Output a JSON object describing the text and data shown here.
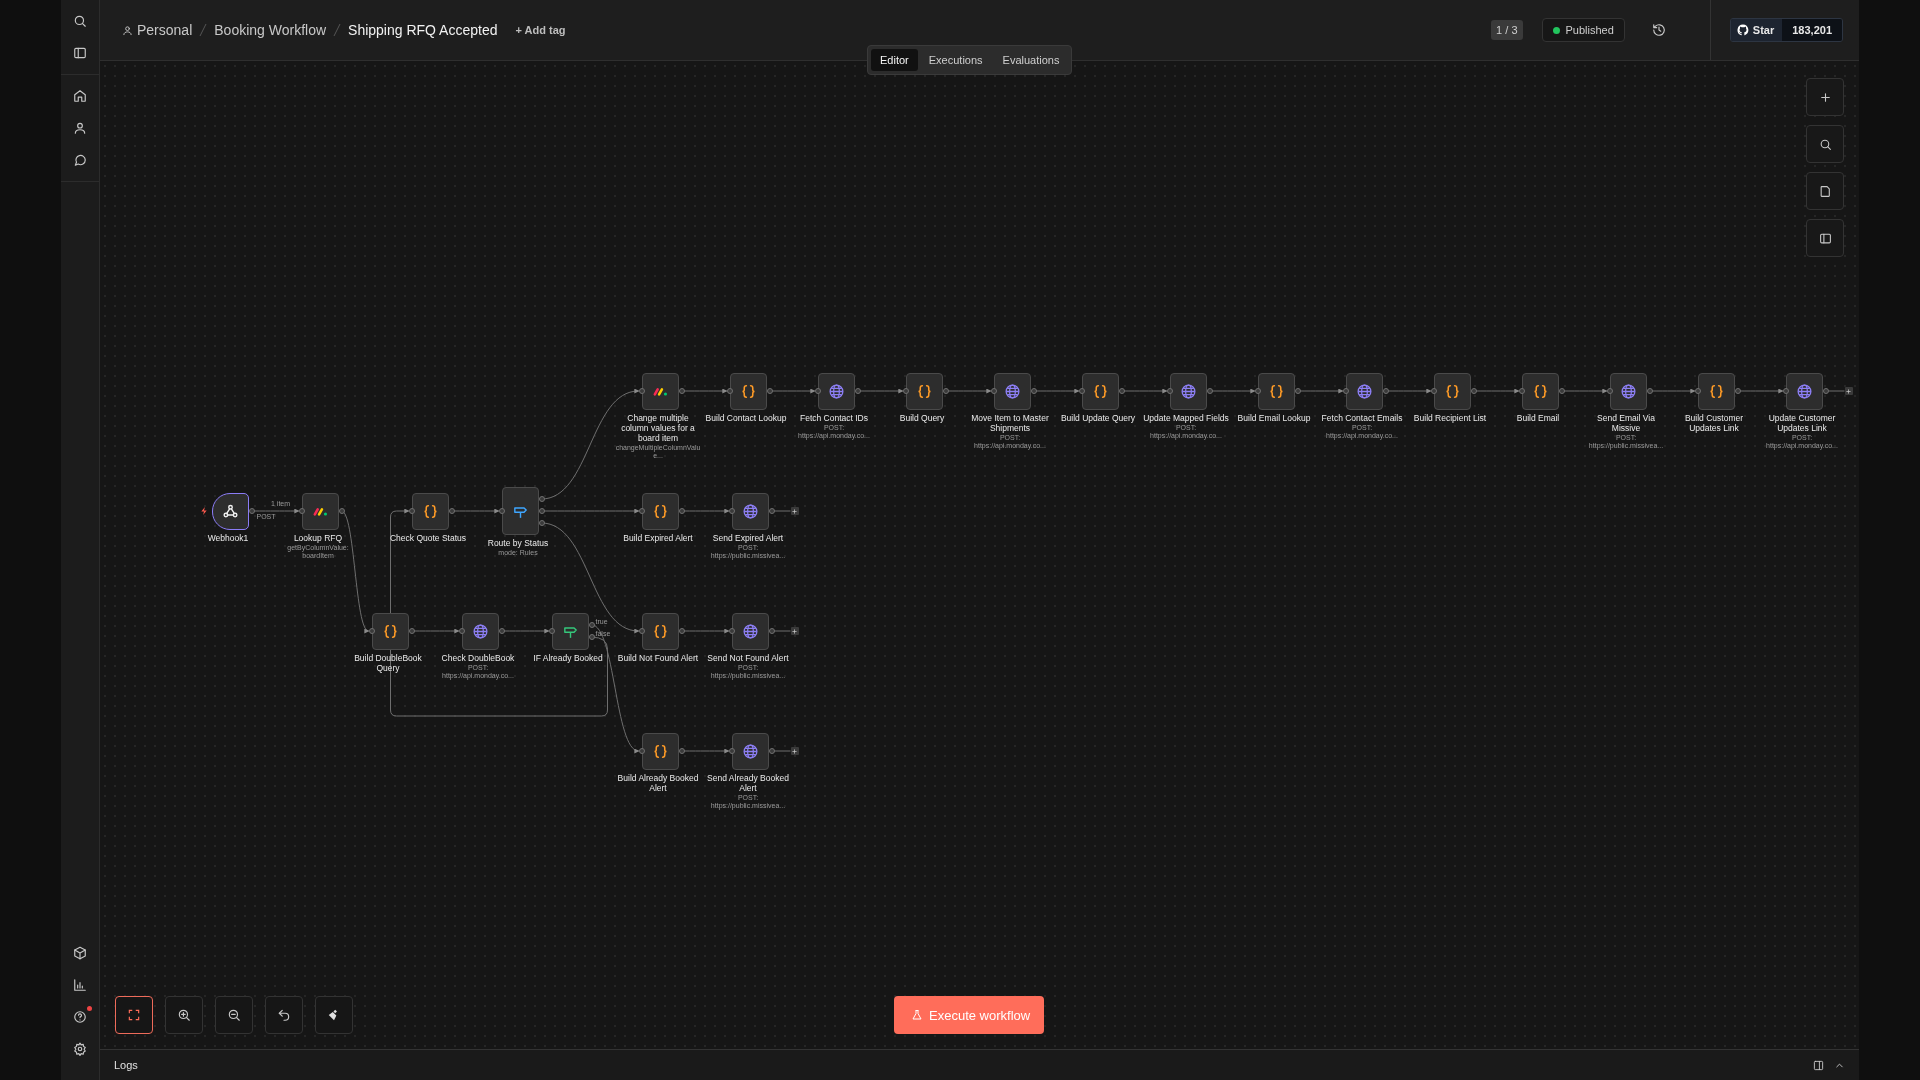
{
  "breadcrumb": {
    "items": [
      "Personal",
      "Booking Workflow",
      "Shipping RFQ Accepted"
    ],
    "add_tag": "+ Add tag"
  },
  "tabs": [
    {
      "label": "Editor",
      "selected": true
    },
    {
      "label": "Executions",
      "selected": false
    },
    {
      "label": "Evaluations",
      "selected": false
    }
  ],
  "version": "1 / 3",
  "status": {
    "label": "Published",
    "color": "#22c55e"
  },
  "github": {
    "label": "Star",
    "count": "183,201"
  },
  "canvas": {
    "nodes": [
      {
        "name": "Webhook1",
        "kind": "webhook",
        "output_label": "1 item",
        "output_tag": "POST",
        "selected": true
      },
      {
        "name": "Lookup RFQ",
        "subtitle": "getByColumnValue: boardItem",
        "kind": "monday",
        "selected": false
      },
      {
        "name": "Check Quote Status",
        "kind": "code",
        "selected": false
      },
      {
        "name": "Route by Status",
        "subtitle": "mode: Rules",
        "kind": "switch",
        "selected": false
      },
      {
        "name": "Build DoubleBook Query",
        "kind": "code",
        "selected": false
      },
      {
        "name": "Check DoubleBook",
        "subtitle": "POST: https://api.monday.co...",
        "kind": "http",
        "selected": false
      },
      {
        "name": "IF Already Booked",
        "kind": "if",
        "outputs": [
          "true",
          "false"
        ],
        "selected": false
      },
      {
        "name": "Change multiple column values for a board item",
        "subtitle": "changeMultipleColumnValue...",
        "kind": "monday",
        "selected": false
      },
      {
        "name": "Build Contact Lookup",
        "kind": "code",
        "selected": false
      },
      {
        "name": "Fetch Contact IDs",
        "subtitle": "POST: https://api.monday.co...",
        "kind": "http",
        "selected": false
      },
      {
        "name": "Build Query",
        "kind": "code",
        "selected": false
      },
      {
        "name": "Move Item to Master Shipments",
        "subtitle": "POST: https://api.monday.co...",
        "kind": "http",
        "selected": false
      },
      {
        "name": "Build Update Query",
        "kind": "code",
        "selected": false
      },
      {
        "name": "Update Mapped Fields",
        "subtitle": "POST: https://api.monday.co...",
        "kind": "http",
        "selected": false
      },
      {
        "name": "Build Email Lookup",
        "kind": "code",
        "selected": false
      },
      {
        "name": "Fetch Contact Emails",
        "subtitle": "POST: https://api.monday.co...",
        "kind": "http",
        "selected": false
      },
      {
        "name": "Build Recipient List",
        "kind": "code",
        "selected": false
      },
      {
        "name": "Build Email",
        "kind": "code",
        "selected": false
      },
      {
        "name": "Send Email Via Missive",
        "subtitle": "POST: https://public.missivea...",
        "kind": "http",
        "selected": false
      },
      {
        "name": "Build Customer Updates Link",
        "kind": "code",
        "selected": false
      },
      {
        "name": "Update Customer Updates Link",
        "subtitle": "POST: https://api.monday.co...",
        "kind": "http",
        "selected": false
      },
      {
        "name": "Build Expired Alert",
        "kind": "code",
        "selected": false
      },
      {
        "name": "Send Expired Alert",
        "subtitle": "POST: https://public.missivea...",
        "kind": "http",
        "selected": false
      },
      {
        "name": "Build Not Found Alert",
        "kind": "code",
        "selected": false
      },
      {
        "name": "Send Not Found Alert",
        "subtitle": "POST: https://public.missivea...",
        "kind": "http",
        "selected": false
      },
      {
        "name": "Build Already Booked Alert",
        "kind": "code",
        "selected": false
      },
      {
        "name": "Send Already Booked Alert",
        "subtitle": "POST: https://public.missivea...",
        "kind": "http",
        "selected": false
      }
    ]
  },
  "zoom_controls": [
    {
      "kind": "fit",
      "highlighted": true
    },
    {
      "kind": "zoom_in",
      "highlighted": false
    },
    {
      "kind": "zoom_out",
      "highlighted": false
    },
    {
      "kind": "undo",
      "highlighted": false
    },
    {
      "kind": "tidy",
      "highlighted": false
    }
  ],
  "execute_button": "Execute workflow",
  "logs": {
    "title": "Logs"
  }
}
